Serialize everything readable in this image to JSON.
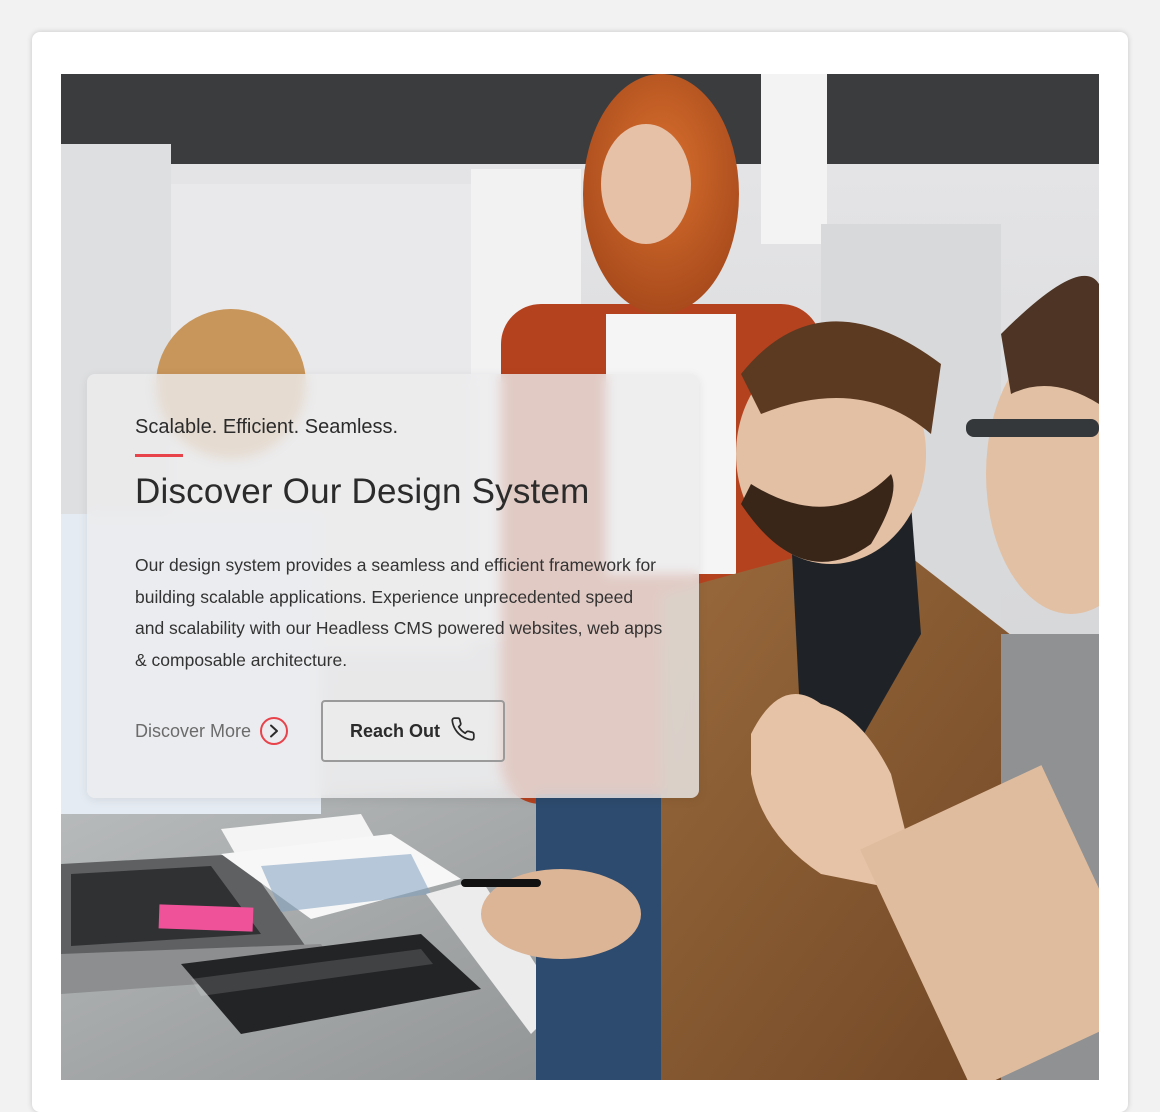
{
  "hero": {
    "eyebrow": "Scalable. Efficient. Seamless.",
    "title": "Discover Our Design System",
    "description": "Our design system provides a seamless and efficient framework for building scalable applications. Experience unprecedented speed and scalability with our Headless CMS powered websites, web apps & composable architecture.",
    "discover_label": "Discover More",
    "discover_icon": "chevron-right-icon",
    "reach_label": "Reach Out",
    "reach_icon": "phone-icon",
    "accent_color": "#e8424b"
  }
}
